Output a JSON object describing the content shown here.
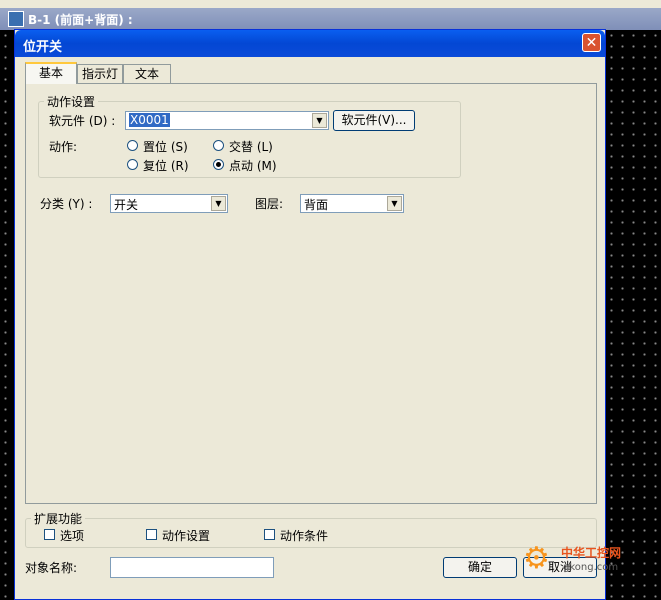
{
  "background_window": {
    "title": "B-1 (前面+背面) :"
  },
  "dialog": {
    "title": "位开关",
    "close_glyph": "✕",
    "tabs": [
      {
        "label": "基本"
      },
      {
        "label": "指示灯"
      },
      {
        "label": "文本"
      }
    ],
    "action_settings": {
      "group_label": "动作设置",
      "device_label": "软元件 (D) :",
      "device_value": "X0001",
      "device_button": "软元件(V)...",
      "action_label": "动作:",
      "options": {
        "set": "置位 (S)",
        "alternate": "交替 (L)",
        "reset": "复位 (R)",
        "momentary": "点动 (M)"
      },
      "selected": "momentary"
    },
    "category": {
      "label": "分类 (Y) :",
      "value": "开关"
    },
    "layer": {
      "label": "图层:",
      "value": "背面"
    },
    "extended": {
      "group_label": "扩展功能",
      "options": {
        "label": "选项",
        "checked": false
      },
      "action_settings": {
        "label": "动作设置",
        "checked": false
      },
      "action_conditions": {
        "label": "动作条件",
        "checked": false
      }
    },
    "object_name": {
      "label": "对象名称:",
      "value": ""
    },
    "ok_label": "确定",
    "cancel_label": "取消"
  },
  "watermark": {
    "brand": "中华工控网",
    "url": "gkong.com"
  },
  "colors": {
    "title_bar": "#0a5ff0",
    "selection": "#316ac5",
    "dialog_bg": "#ece9d8"
  }
}
